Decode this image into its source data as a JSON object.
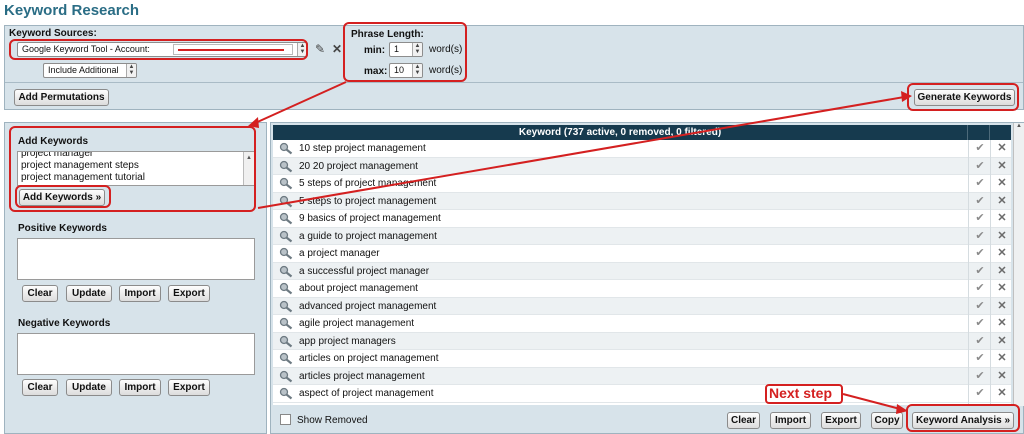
{
  "page": {
    "title": "Keyword Research"
  },
  "sources": {
    "label": "Keyword Sources:",
    "source_select_prefix": "Google Keyword Tool - Account:",
    "include_additional": "Include Additional"
  },
  "phrase_length": {
    "label": "Phrase Length:",
    "min_label": "min:",
    "min_value": "1",
    "max_label": "max:",
    "max_value": "10",
    "unit": "word(s)"
  },
  "buttons": {
    "add_permutations": "Add Permutations",
    "generate_keywords": "Generate Keywords",
    "add_keywords": "Add Keywords »",
    "clear": "Clear",
    "update": "Update",
    "import": "Import",
    "export": "Export",
    "copy": "Copy",
    "keyword_analysis": "Keyword Analysis »"
  },
  "add_keywords": {
    "label": "Add Keywords",
    "lines": [
      "project manager",
      "project management steps",
      "project management tutorial"
    ]
  },
  "positive_keywords": {
    "label": "Positive Keywords"
  },
  "negative_keywords": {
    "label": "Negative Keywords"
  },
  "keyword_table": {
    "header": "Keyword (737 active, 0 removed, 0 filtered)",
    "rows": [
      "10 step project management",
      "20 20 project management",
      "5 steps of project management",
      "5 steps to project management",
      "9 basics of project management",
      "a guide to project management",
      "a project manager",
      "a successful project manager",
      "about project management",
      "advanced project management",
      "agile project management",
      "app project managers",
      "articles on project management",
      "articles project management",
      "aspect of project management"
    ],
    "show_removed": "Show Removed"
  },
  "annotations": {
    "next_step": "Next step"
  },
  "colors": {
    "accent_red": "#d42020",
    "header_dark": "#163a4e",
    "panel_bg": "#d7e3ea",
    "title_teal": "#2a6d85"
  }
}
